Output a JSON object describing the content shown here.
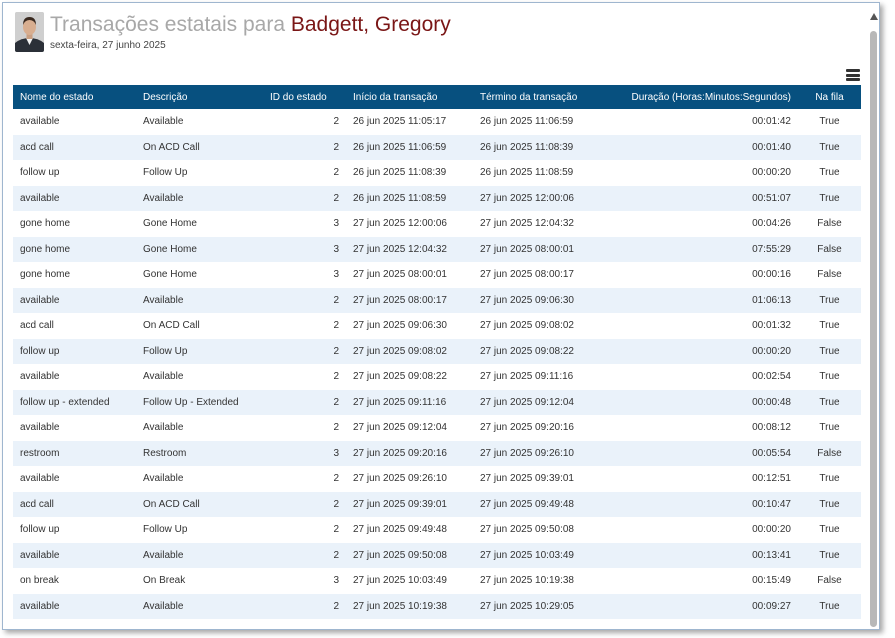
{
  "header": {
    "title_prefix": "Transações estatais para ",
    "agent_name": "Badgett, Gregory",
    "date": "sexta-feira, 27 junho 2025"
  },
  "table": {
    "columns": [
      "Nome do estado",
      "Descrição",
      "ID do estado",
      "Início da transação",
      "Término da transação",
      "Duração (Horas:Minutos:Segundos)",
      "Na fila"
    ],
    "rows": [
      [
        "available",
        "Available",
        "2",
        "26 jun 2025 11:05:17",
        "26 jun 2025 11:06:59",
        "00:01:42",
        "True"
      ],
      [
        "acd call",
        "On ACD Call",
        "2",
        "26 jun 2025 11:06:59",
        "26 jun 2025 11:08:39",
        "00:01:40",
        "True"
      ],
      [
        "follow up",
        "Follow Up",
        "2",
        "26 jun 2025 11:08:39",
        "26 jun 2025 11:08:59",
        "00:00:20",
        "True"
      ],
      [
        "available",
        "Available",
        "2",
        "26 jun 2025 11:08:59",
        "27 jun 2025 12:00:06",
        "00:51:07",
        "True"
      ],
      [
        "gone home",
        "Gone Home",
        "3",
        "27 jun 2025 12:00:06",
        "27 jun 2025 12:04:32",
        "00:04:26",
        "False"
      ],
      [
        "gone home",
        "Gone Home",
        "3",
        "27 jun 2025 12:04:32",
        "27 jun 2025 08:00:01",
        "07:55:29",
        "False"
      ],
      [
        "gone home",
        "Gone Home",
        "3",
        "27 jun 2025 08:00:01",
        "27 jun 2025 08:00:17",
        "00:00:16",
        "False"
      ],
      [
        "available",
        "Available",
        "2",
        "27 jun 2025 08:00:17",
        "27 jun 2025 09:06:30",
        "01:06:13",
        "True"
      ],
      [
        "acd call",
        "On ACD Call",
        "2",
        "27 jun 2025 09:06:30",
        "27 jun 2025 09:08:02",
        "00:01:32",
        "True"
      ],
      [
        "follow up",
        "Follow Up",
        "2",
        "27 jun 2025 09:08:02",
        "27 jun 2025 09:08:22",
        "00:00:20",
        "True"
      ],
      [
        "available",
        "Available",
        "2",
        "27 jun 2025 09:08:22",
        "27 jun 2025 09:11:16",
        "00:02:54",
        "True"
      ],
      [
        "follow up - extended",
        "Follow Up - Extended",
        "2",
        "27 jun 2025 09:11:16",
        "27 jun 2025 09:12:04",
        "00:00:48",
        "True"
      ],
      [
        "available",
        "Available",
        "2",
        "27 jun 2025 09:12:04",
        "27 jun 2025 09:20:16",
        "00:08:12",
        "True"
      ],
      [
        "restroom",
        "Restroom",
        "3",
        "27 jun 2025 09:20:16",
        "27 jun 2025 09:26:10",
        "00:05:54",
        "False"
      ],
      [
        "available",
        "Available",
        "2",
        "27 jun 2025 09:26:10",
        "27 jun 2025 09:39:01",
        "00:12:51",
        "True"
      ],
      [
        "acd call",
        "On ACD Call",
        "2",
        "27 jun 2025 09:39:01",
        "27 jun 2025 09:49:48",
        "00:10:47",
        "True"
      ],
      [
        "follow up",
        "Follow Up",
        "2",
        "27 jun 2025 09:49:48",
        "27 jun 2025 09:50:08",
        "00:00:20",
        "True"
      ],
      [
        "available",
        "Available",
        "2",
        "27 jun 2025 09:50:08",
        "27 jun 2025 10:03:49",
        "00:13:41",
        "True"
      ],
      [
        "on break",
        "On Break",
        "3",
        "27 jun 2025 10:03:49",
        "27 jun 2025 10:19:38",
        "00:15:49",
        "False"
      ],
      [
        "available",
        "Available",
        "2",
        "27 jun 2025 10:19:38",
        "27 jun 2025 10:29:05",
        "00:09:27",
        "True"
      ]
    ]
  },
  "icons": {
    "menu": "hamburger-menu-icon",
    "scroll_up": "chevron-up-icon"
  },
  "colors": {
    "header_bg": "#07507f",
    "agent_name": "#7a1616",
    "title_prefix": "#a8a8a8",
    "row_alt": "#eaf2fa"
  }
}
